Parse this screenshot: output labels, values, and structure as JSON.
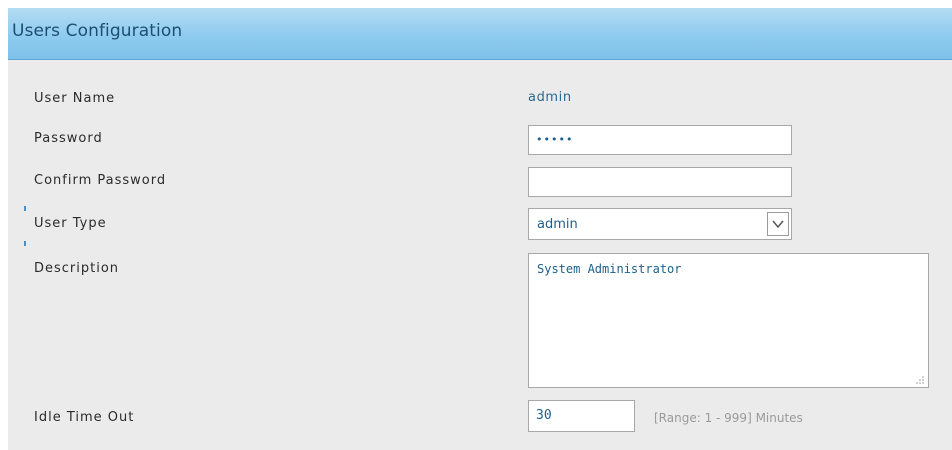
{
  "header": {
    "title": "Users Configuration"
  },
  "fields": {
    "user_name": {
      "label": "User Name",
      "value": "admin"
    },
    "password": {
      "label": "Password",
      "value": "•••••"
    },
    "confirm_password": {
      "label": "Confirm Password",
      "value": ""
    },
    "user_type": {
      "label": "User Type",
      "value": "admin"
    },
    "description": {
      "label": "Description",
      "value": "System Administrator"
    },
    "idle_timeout": {
      "label": "Idle Time Out",
      "value": "30",
      "hint": "[Range: 1 - 999] Minutes"
    }
  },
  "icons": {
    "dropdown": "chevron-down-icon",
    "resize": "resize-grip-icon"
  }
}
